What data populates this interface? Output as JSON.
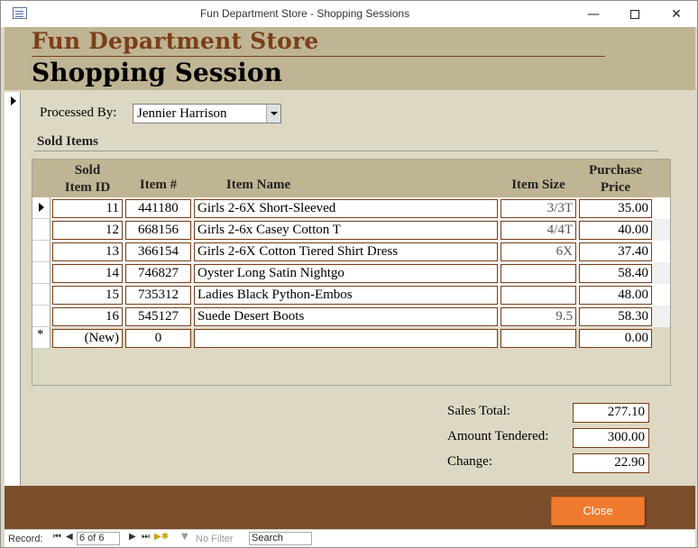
{
  "window": {
    "title": "Fun Department Store - Shopping Sessions"
  },
  "header": {
    "store_name": "Fun Department Store",
    "form_title": "Shopping Session"
  },
  "processed_by": {
    "label": "Processed By:",
    "value": "Jennier Harrison"
  },
  "sold_items": {
    "label": "Sold Items",
    "columns": {
      "sold_item_id": [
        "Sold",
        "Item ID"
      ],
      "item_number": "Item #",
      "item_name": "Item Name",
      "item_size": "Item Size",
      "purchase_price": [
        "Purchase",
        "Price"
      ]
    },
    "rows": [
      {
        "id": "11",
        "item": "441180",
        "name": "Girls 2-6X Short-Sleeved",
        "size": "3/3T",
        "price": "35.00"
      },
      {
        "id": "12",
        "item": "668156",
        "name": "Girls 2-6x Casey Cotton T",
        "size": "4/4T",
        "price": "40.00"
      },
      {
        "id": "13",
        "item": "366154",
        "name": "Girls 2-6X Cotton Tiered Shirt Dress",
        "size": "6X",
        "price": "37.40"
      },
      {
        "id": "14",
        "item": "746827",
        "name": "Oyster Long Satin Nightgo",
        "size": "",
        "price": "58.40"
      },
      {
        "id": "15",
        "item": "735312",
        "name": "Ladies Black Python-Embos",
        "size": "",
        "price": "48.00"
      },
      {
        "id": "16",
        "item": "545127",
        "name": "Suede Desert Boots",
        "size": "9.5",
        "price": "58.30"
      }
    ],
    "new_row": {
      "id": "(New)",
      "item": "0",
      "name": "",
      "size": "",
      "price": "0.00"
    }
  },
  "totals": {
    "sales_total_label": "Sales Total:",
    "sales_total": "277.10",
    "amount_tendered_label": "Amount Tendered:",
    "amount_tendered": "300.00",
    "change_label": "Change:",
    "change": "22.90"
  },
  "footer": {
    "close_label": "Close"
  },
  "navigation": {
    "record_label": "Record:",
    "record_value": "6 of 6",
    "filter_label": "No Filter",
    "search_placeholder": "Search"
  }
}
